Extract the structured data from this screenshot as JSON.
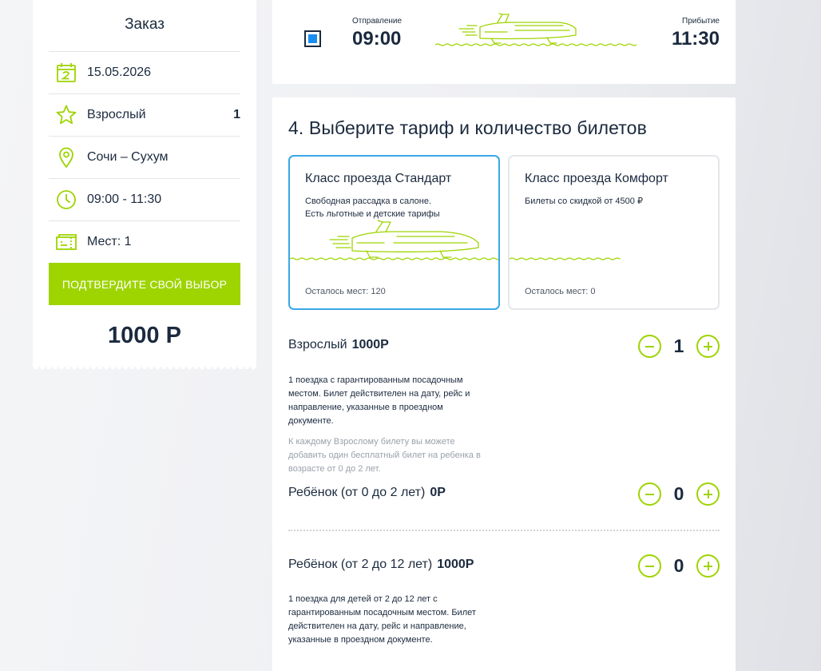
{
  "order": {
    "title": "Заказ",
    "date": "15.05.2026",
    "passenger_type": "Взрослый",
    "passenger_count": "1",
    "route": "Сочи – Сухум",
    "time": "09:00 - 11:30",
    "seats": "Мест: 1",
    "confirm_label": "ПОДТВЕРДИТЕ СВОЙ ВЫБОР",
    "total": "1000 Р"
  },
  "trip": {
    "departure_label": "Отправление",
    "departure_time": "09:00",
    "arrival_label": "Прибытие",
    "arrival_time": "11:30"
  },
  "tariff": {
    "title": "4. Выберите тариф и количество билетов",
    "classes": [
      {
        "name": "Класс проезда Стандарт",
        "desc_line1": "Свободная рассадка в салоне.",
        "desc_line2": "Есть льготные и детские тарифы",
        "seats_left": "Осталось мест: 120",
        "selected": true
      },
      {
        "name": "Класс проезда Комфорт",
        "desc_line1": "Билеты со скидкой от 4500 ₽",
        "desc_line2": "",
        "seats_left": "Осталось мест: 0",
        "selected": false
      }
    ],
    "passengers": [
      {
        "label": "Взрослый",
        "price": "1000Р",
        "count": "1",
        "desc": [
          "1 поездка с гарантированным посадочным",
          "местом. Билет действителен на дату, рейс и",
          "направление, указанные в проездном",
          "документе."
        ],
        "note": [
          "К каждому Взрослому билету вы можете",
          "добавить один бесплатный билет на ребенка в",
          "возрасте от 0 до 2 лет."
        ]
      },
      {
        "label": "Ребёнок (от 0 до 2 лет)",
        "price": "0Р",
        "count": "0"
      },
      {
        "label": "Ребёнок (от 2 до 12 лет)",
        "price": "1000Р",
        "count": "0",
        "desc": [
          "1 поездка для детей от 2 до 12 лет с",
          "гарантированным посадочным местом. Билет",
          "действителен на дату, рейс и направление,",
          "указанные в проездном документе."
        ]
      }
    ]
  },
  "colors": {
    "accent_green": "#9ed400",
    "selected_border": "#3aa7e8",
    "checkbox_fill": "#1a8df0",
    "text_dark": "#1b2a3e"
  },
  "icons": [
    "calendar-icon",
    "star-icon",
    "location-pin-icon",
    "clock-icon",
    "ticket-icon",
    "hydrofoil-boat-icon"
  ]
}
